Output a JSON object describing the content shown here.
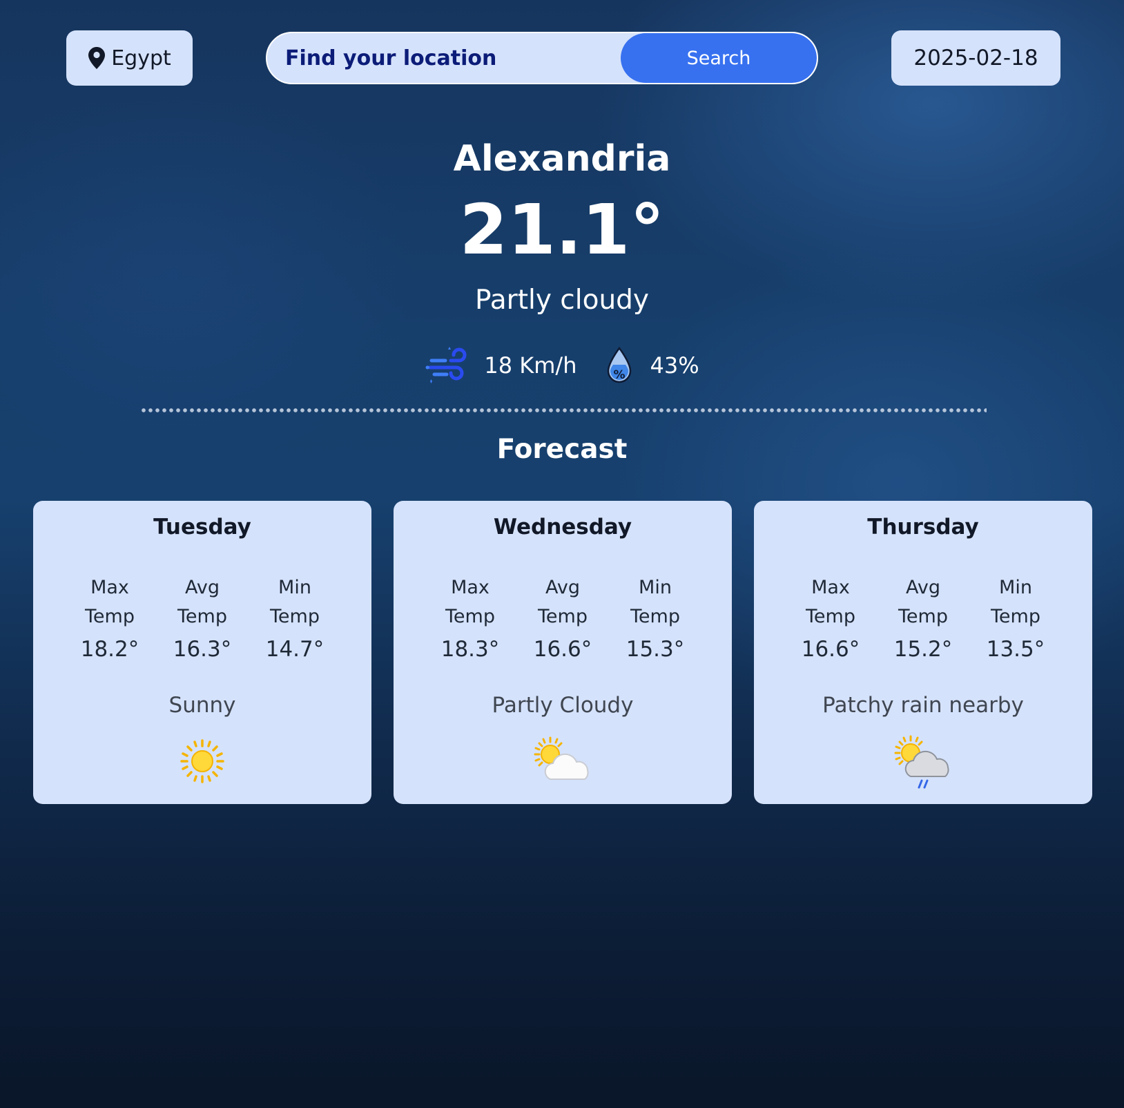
{
  "header": {
    "country": "Egypt",
    "search_placeholder": "Find your location",
    "search_button": "Search",
    "date": "2025-02-18"
  },
  "current": {
    "city": "Alexandria",
    "temperature": "21.1°",
    "condition": "Partly cloudy",
    "wind": "18 Km/h",
    "humidity": "43%",
    "wind_icon": "wind-icon",
    "humidity_icon": "humidity-drop-icon"
  },
  "forecast": {
    "title": "Forecast",
    "labels": {
      "max_line1": "Max",
      "avg_line1": "Avg",
      "min_line1": "Min",
      "line2": "Temp"
    },
    "days": [
      {
        "day": "Tuesday",
        "max": "18.2°",
        "avg": "16.3°",
        "min": "14.7°",
        "condition": "Sunny",
        "icon": "sun-icon"
      },
      {
        "day": "Wednesday",
        "max": "18.3°",
        "avg": "16.6°",
        "min": "15.3°",
        "condition": "Partly Cloudy",
        "icon": "partly-cloudy-icon"
      },
      {
        "day": "Thursday",
        "max": "16.6°",
        "avg": "15.2°",
        "min": "13.5°",
        "condition": "Patchy rain nearby",
        "icon": "patchy-rain-icon"
      }
    ]
  },
  "colors": {
    "card_bg": "#d5e2fb",
    "accent": "#3771f0",
    "search_text": "#0b1c78"
  }
}
